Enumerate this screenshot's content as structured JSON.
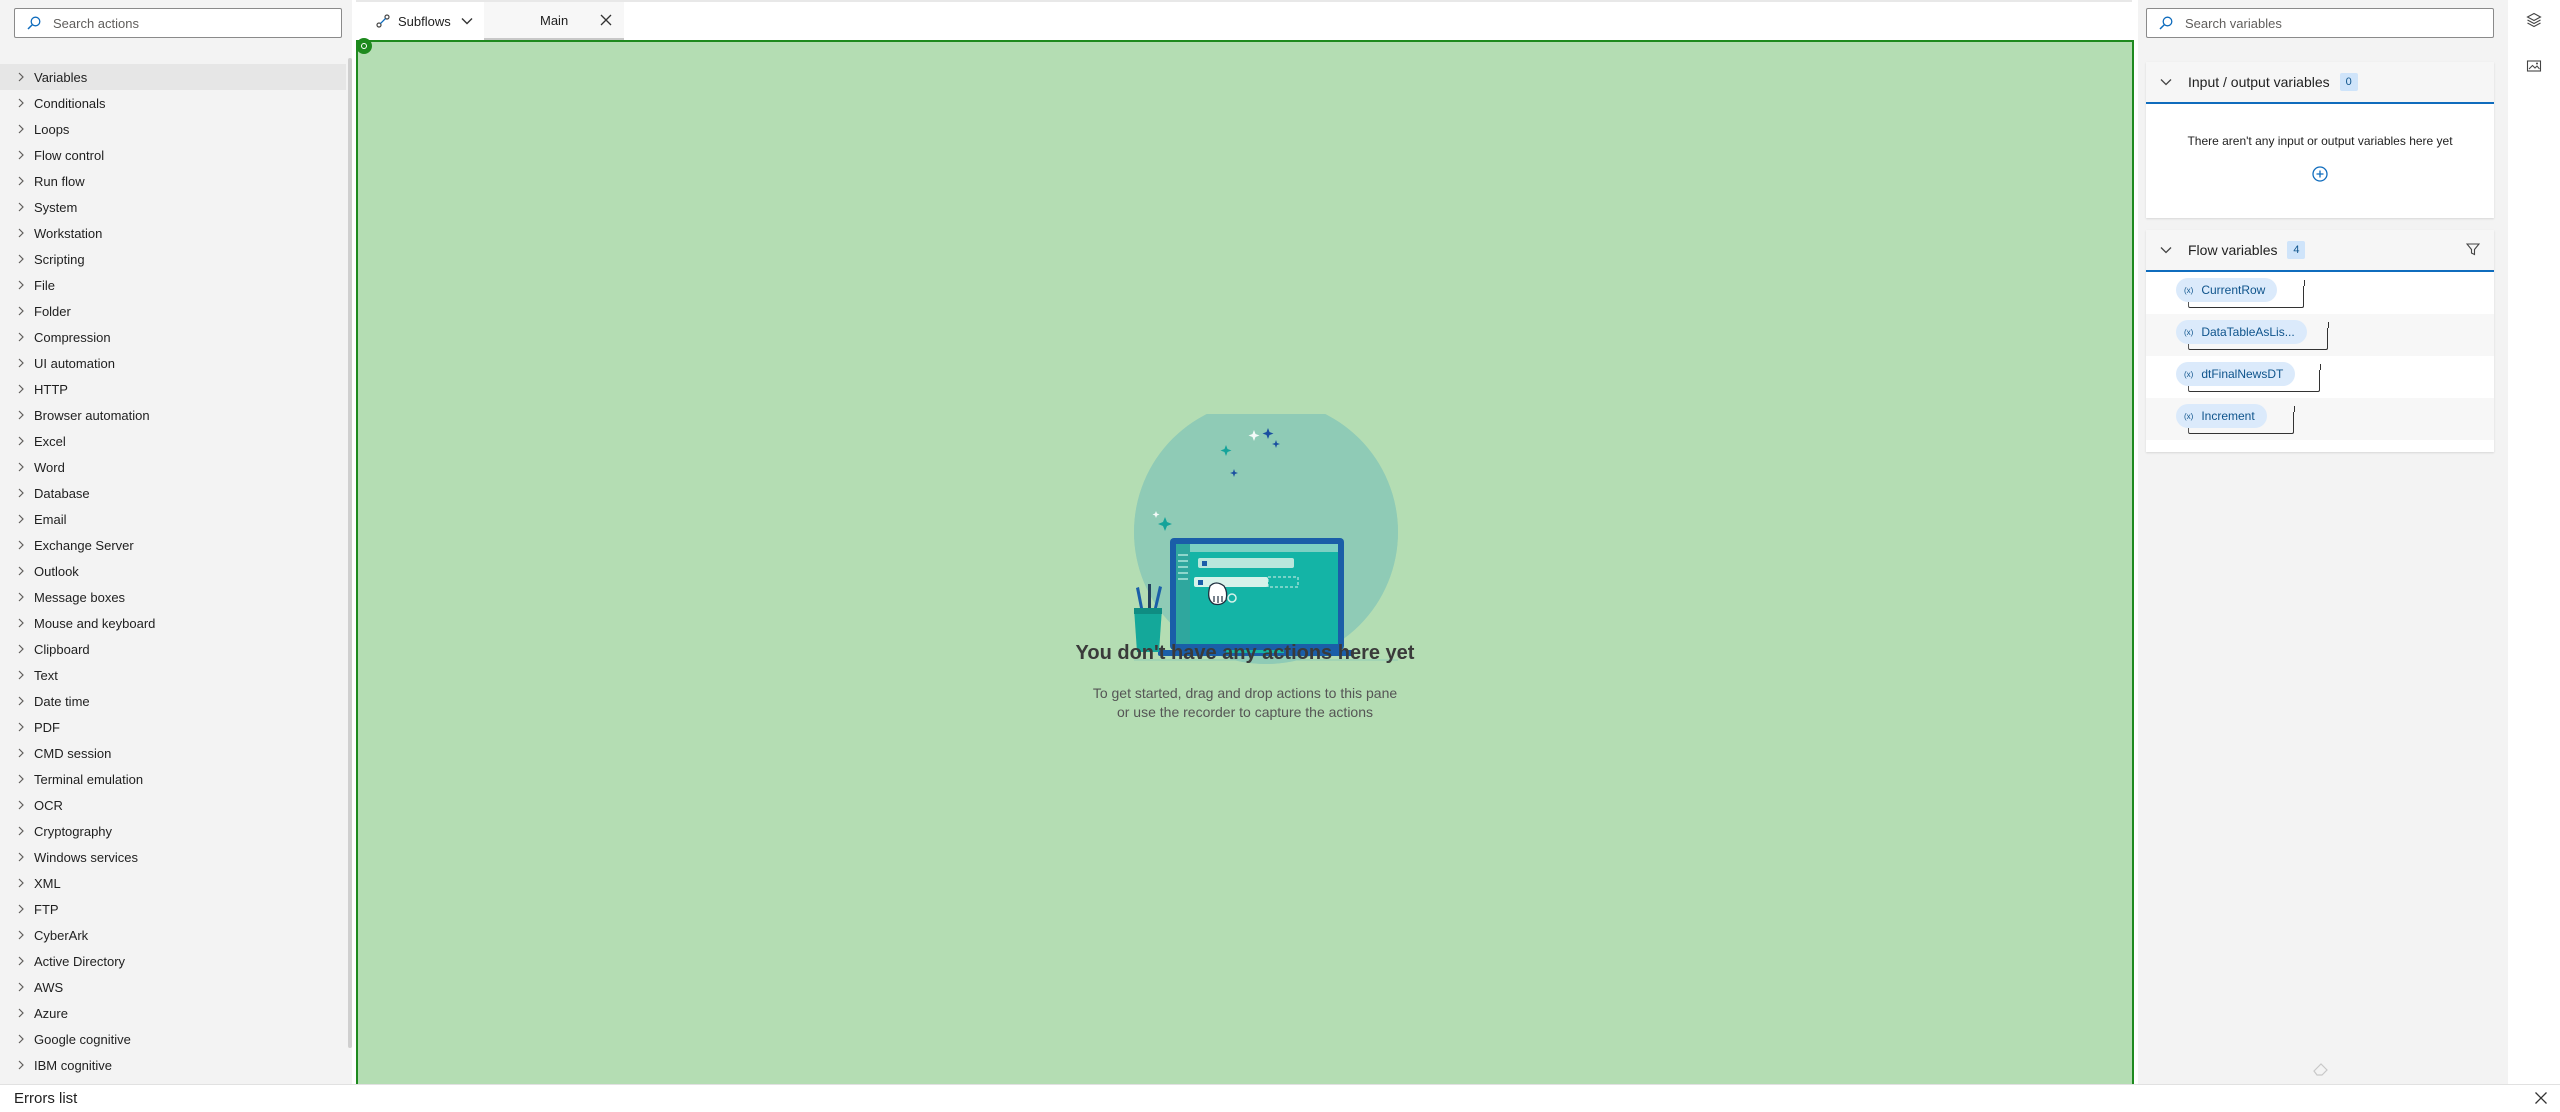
{
  "actions_pane": {
    "search_placeholder": "Search actions",
    "items": [
      {
        "label": "Variables"
      },
      {
        "label": "Conditionals"
      },
      {
        "label": "Loops"
      },
      {
        "label": "Flow control"
      },
      {
        "label": "Run flow"
      },
      {
        "label": "System"
      },
      {
        "label": "Workstation"
      },
      {
        "label": "Scripting"
      },
      {
        "label": "File"
      },
      {
        "label": "Folder"
      },
      {
        "label": "Compression"
      },
      {
        "label": "UI automation"
      },
      {
        "label": "HTTP"
      },
      {
        "label": "Browser automation"
      },
      {
        "label": "Excel"
      },
      {
        "label": "Word"
      },
      {
        "label": "Database"
      },
      {
        "label": "Email"
      },
      {
        "label": "Exchange Server"
      },
      {
        "label": "Outlook"
      },
      {
        "label": "Message boxes"
      },
      {
        "label": "Mouse and keyboard"
      },
      {
        "label": "Clipboard"
      },
      {
        "label": "Text"
      },
      {
        "label": "Date time"
      },
      {
        "label": "PDF"
      },
      {
        "label": "CMD session"
      },
      {
        "label": "Terminal emulation"
      },
      {
        "label": "OCR"
      },
      {
        "label": "Cryptography"
      },
      {
        "label": "Windows services"
      },
      {
        "label": "XML"
      },
      {
        "label": "FTP"
      },
      {
        "label": "CyberArk"
      },
      {
        "label": "Active Directory"
      },
      {
        "label": "AWS"
      },
      {
        "label": "Azure"
      },
      {
        "label": "Google cognitive"
      },
      {
        "label": "IBM cognitive"
      }
    ]
  },
  "tabs": {
    "subflows_label": "Subflows",
    "main_label": "Main"
  },
  "canvas": {
    "empty_title": "You don't have any actions here yet",
    "empty_line1": "To get started, drag and drop actions to this pane",
    "empty_line2": "or use the recorder to capture the actions"
  },
  "variables_pane": {
    "search_placeholder": "Search variables",
    "io_section": {
      "title": "Input / output variables",
      "count": "0",
      "empty_text": "There aren't any input or output variables here yet"
    },
    "flow_section": {
      "title": "Flow variables",
      "count": "4",
      "variables": [
        {
          "name": "CurrentRow"
        },
        {
          "name": "DataTableAsLis..."
        },
        {
          "name": "dtFinalNewsDT"
        },
        {
          "name": "Increment"
        }
      ]
    }
  },
  "errors_panel": {
    "title": "Errors list"
  },
  "colors": {
    "canvas_bg": "#b4ddb3",
    "canvas_border": "#1e8a1e",
    "accent": "#0f6cbd",
    "variable_pill": "#dbeafb"
  }
}
